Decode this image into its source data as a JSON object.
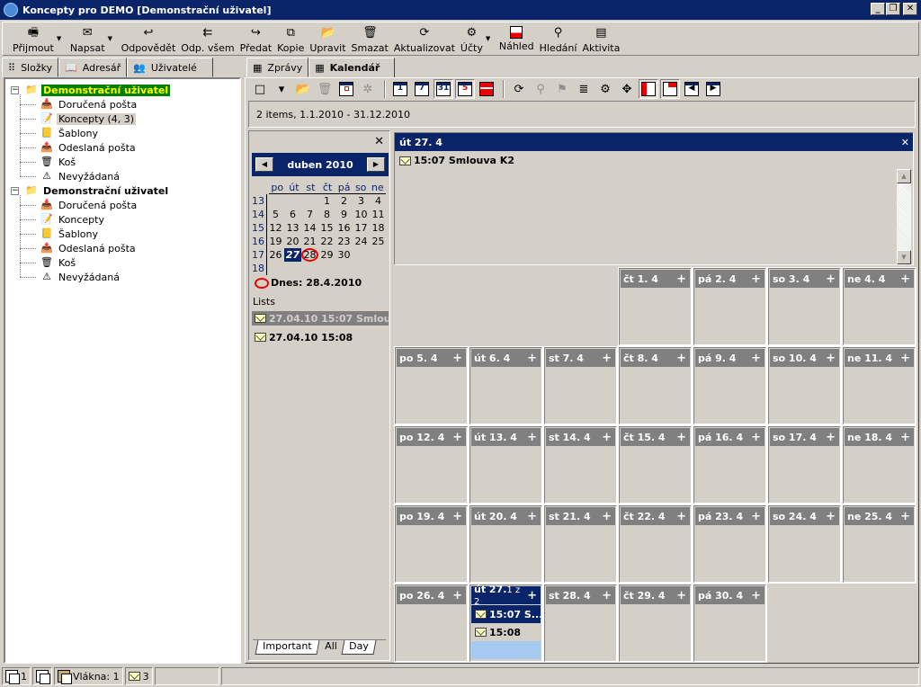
{
  "window": {
    "title": "Koncepty pro DEMO [Demonstrační uživatel]",
    "buttons": {
      "minimize": "_",
      "restore": "❐",
      "close": "✕"
    }
  },
  "toolbar": {
    "items": [
      {
        "label": "Přijmout",
        "icon": "receive-icon",
        "dropdown": true
      },
      {
        "label": "Napsat",
        "icon": "compose-icon",
        "dropdown": true
      },
      {
        "label": "Odpovědět",
        "icon": "reply-icon"
      },
      {
        "label": "Odp. všem",
        "icon": "reply-all-icon"
      },
      {
        "label": "Předat",
        "icon": "forward-icon"
      },
      {
        "label": "Kopie",
        "icon": "copy-icon"
      },
      {
        "label": "Upravit",
        "icon": "edit-folder-icon"
      },
      {
        "label": "Smazat",
        "icon": "trash-icon"
      },
      {
        "label": "Aktualizovat",
        "icon": "refresh-icon"
      },
      {
        "label": "Účty",
        "icon": "accounts-icon",
        "dropdown": true
      },
      {
        "label": "Náhled",
        "icon": "preview-icon"
      },
      {
        "label": "Hledání",
        "icon": "binoculars-icon"
      },
      {
        "label": "Aktivita",
        "icon": "activity-icon"
      }
    ]
  },
  "left_tabs": [
    {
      "label": "Složky",
      "icon": "folder-tree-icon"
    },
    {
      "label": "Adresář",
      "icon": "address-book-icon"
    },
    {
      "label": "Uživatelé",
      "icon": "users-icon"
    }
  ],
  "right_tabs": [
    {
      "label": "Zprávy",
      "icon": "messages-icon"
    },
    {
      "label": "Kalendář",
      "icon": "calendar-icon",
      "active": true
    }
  ],
  "tree": [
    {
      "label": "Demonstrační uživatel",
      "selected": true,
      "children": [
        {
          "label": "Doručená pošta",
          "icon": "inbox-icon"
        },
        {
          "label": "Koncepty (4, 3)",
          "icon": "drafts-icon",
          "highlighted": true
        },
        {
          "label": "Šablony",
          "icon": "templates-icon"
        },
        {
          "label": "Odeslaná pošta",
          "icon": "sent-icon"
        },
        {
          "label": "Koš",
          "icon": "trash-icon"
        },
        {
          "label": "Nevyžádaná",
          "icon": "junk-icon"
        }
      ]
    },
    {
      "label": "Demonstrační uživatel",
      "selected": false,
      "children": [
        {
          "label": "Doručená pošta",
          "icon": "inbox-icon"
        },
        {
          "label": "Koncepty",
          "icon": "drafts-icon"
        },
        {
          "label": "Šablony",
          "icon": "templates-icon"
        },
        {
          "label": "Odeslaná pošta",
          "icon": "sent-icon"
        },
        {
          "label": "Koš",
          "icon": "trash-icon"
        },
        {
          "label": "Nevyžádaná",
          "icon": "junk-icon"
        }
      ]
    }
  ],
  "calendar_toolbar": {
    "buttons": [
      "new-icon",
      "dropdown-arrow-icon",
      "open-icon",
      "delete-icon",
      "goto-date-icon",
      "clear-icon",
      "day-view-icon",
      "week-view-icon",
      "month-view-icon",
      "work-week-icon",
      "list-view-icon",
      "refresh-icon",
      "find-icon",
      "filter-icon",
      "categories-icon",
      "settings-icon",
      "fit-icon",
      "split-left-icon",
      "split-top-icon",
      "prev-icon",
      "next-icon"
    ],
    "day_view_label": "1",
    "week_view_label": "7",
    "month_view_label": "31",
    "work_week_label": "5"
  },
  "info": "2 items, 1.1.2010 - 31.12.2010",
  "mini_calendar": {
    "close": "✕",
    "month_label": "duben 2010",
    "prev": "◀",
    "next": "▶",
    "weekdays": [
      "po",
      "út",
      "st",
      "čt",
      "pá",
      "so",
      "ne"
    ],
    "weeks": [
      {
        "num": "13",
        "days": [
          "",
          "",
          "",
          "1",
          "2",
          "3",
          "4"
        ]
      },
      {
        "num": "14",
        "days": [
          "5",
          "6",
          "7",
          "8",
          "9",
          "10",
          "11"
        ]
      },
      {
        "num": "15",
        "days": [
          "12",
          "13",
          "14",
          "15",
          "16",
          "17",
          "18"
        ]
      },
      {
        "num": "16",
        "days": [
          "19",
          "20",
          "21",
          "22",
          "23",
          "24",
          "25"
        ]
      },
      {
        "num": "17",
        "days": [
          "26",
          "27",
          "28",
          "29",
          "30",
          "",
          ""
        ]
      },
      {
        "num": "18",
        "days": [
          "",
          "",
          "",
          "",
          "",
          "",
          ""
        ]
      }
    ],
    "selected_day": "27",
    "today_day": "28",
    "today_label": "Dnes: 28.4.2010",
    "lists_label": "Lists",
    "list_items": [
      {
        "text": "27.04.10 15:07 Smlou...",
        "selected": true
      },
      {
        "text": "27.04.10 15:08",
        "selected": false
      }
    ],
    "bottom_tabs": [
      "Important",
      "All",
      "Day"
    ],
    "active_bottom_tab": "All"
  },
  "day_view": {
    "header": "út 27. 4",
    "close": "✕",
    "items": [
      {
        "text": "15:07 Smlouva K2"
      }
    ]
  },
  "month_grid": {
    "rows": [
      [
        "",
        "",
        "",
        "čt 1. 4",
        "pá 2. 4",
        "so 3. 4",
        "ne 4. 4"
      ],
      [
        "po 5. 4",
        "út 6. 4",
        "st 7. 4",
        "čt 8. 4",
        "pá 9. 4",
        "so 10. 4",
        "ne 11. 4"
      ],
      [
        "po 12. 4",
        "út 13. 4",
        "st 14. 4",
        "čt 15. 4",
        "pá 16. 4",
        "so 17. 4",
        "ne 18. 4"
      ],
      [
        "po 19. 4",
        "út 20. 4",
        "st 21. 4",
        "čt 22. 4",
        "pá 23. 4",
        "so 24. 4",
        "ne 25. 4"
      ],
      [
        "po 26. 4",
        "út 27.",
        "st 28. 4",
        "čt 29. 4",
        "pá 30. 4",
        "",
        ""
      ]
    ],
    "plus": "+",
    "selected_cell_suffix": "1 z 2",
    "selected_cell_events": [
      "15:07 S...",
      "15:08"
    ]
  },
  "status_bar": {
    "count1": "1",
    "threads": "Vlákna: 1",
    "mail_count": "3"
  }
}
